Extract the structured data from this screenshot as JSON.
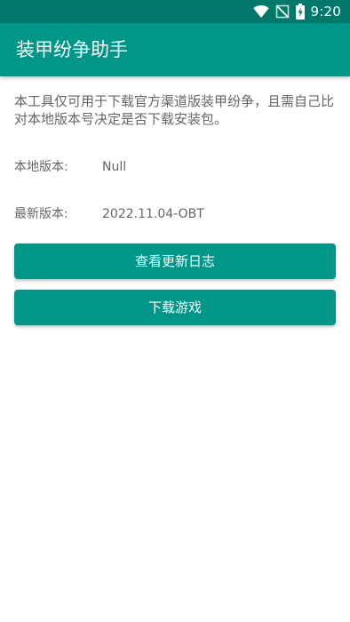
{
  "status_bar": {
    "time": "9:20",
    "icons": [
      "wifi-icon",
      "no-signal-icon",
      "battery-charging-icon"
    ]
  },
  "app_bar": {
    "title": "装甲纷争助手"
  },
  "main": {
    "description": "本工具仅可用于下载官方渠道版装甲纷争，且需自己比对本地版本号决定是否下载安装包。",
    "local_version": {
      "label": "本地版本:",
      "value": "Null"
    },
    "latest_version": {
      "label": "最新版本:",
      "value": "2022.11.04-OBT"
    },
    "buttons": {
      "changelog": "查看更新日志",
      "download": "下载游戏"
    }
  },
  "colors": {
    "status_bar": "#00796b",
    "app_bar": "#009688",
    "button": "#009688",
    "text_secondary": "#666666"
  }
}
